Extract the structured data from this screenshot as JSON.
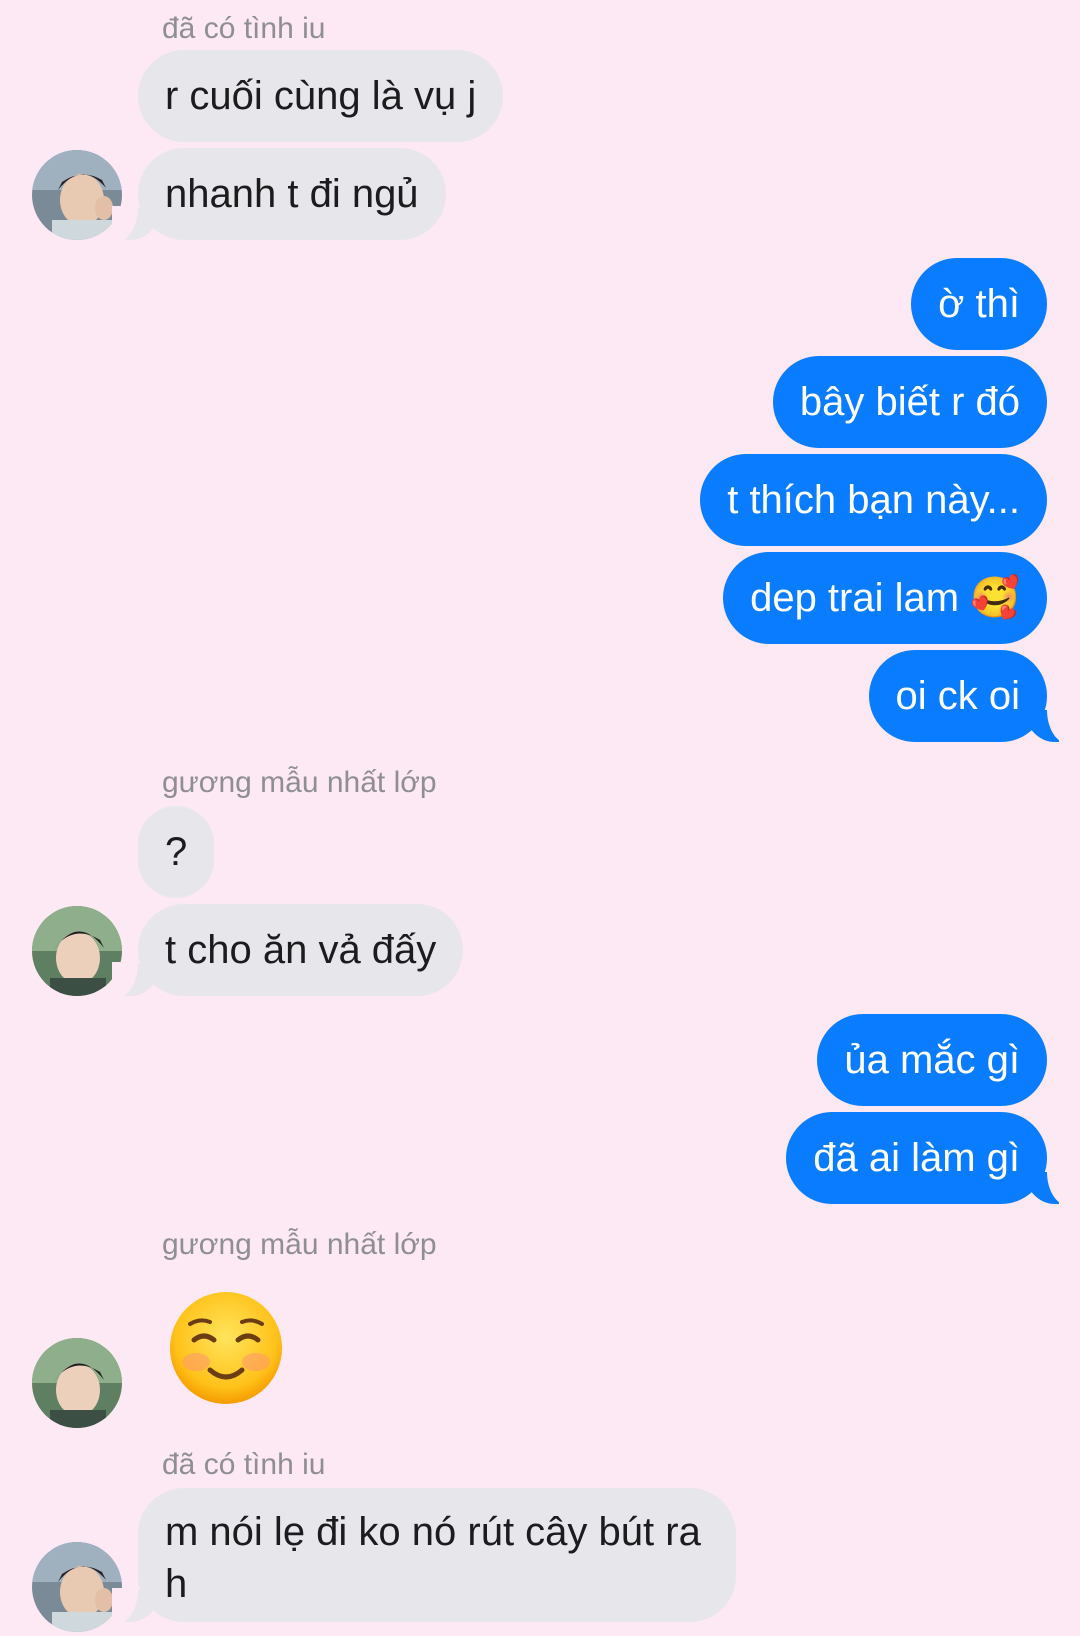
{
  "messages": {
    "group1": {
      "sender": "đã có tình iu",
      "m1": "r cuối cùng là vụ j",
      "m2": "nhanh t đi ngủ"
    },
    "out1": {
      "m1": "ờ thì",
      "m2": "bây biết r đó",
      "m3": "t thích bạn này...",
      "m4_text": "dep trai lam",
      "m4_emoji": "🥰",
      "m5": "oi ck oi"
    },
    "group2": {
      "sender": "gương mẫu nhất lớp",
      "m1": "?",
      "m2": "t cho ăn vả đấy"
    },
    "out2": {
      "m1": "ủa mắc gì",
      "m2": "đã ai làm gì"
    },
    "group3": {
      "sender": "gương mẫu nhất lớp",
      "emoji_name": "smiling-face-icon"
    },
    "group4": {
      "sender": "đã có tình iu",
      "m1": "m nói lẹ đi ko nó rút cây bút ra h"
    }
  },
  "colors": {
    "background": "#fde9f3",
    "incoming": "#e6e6eb",
    "outgoing": "#0a7cff",
    "sender_label": "#8e8e93"
  }
}
